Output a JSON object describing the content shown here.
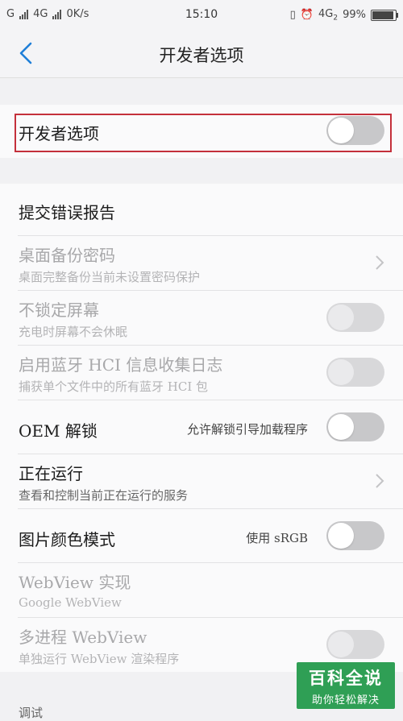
{
  "status_bar": {
    "signal1": "G",
    "signal2": "4G",
    "speed": "0K/s",
    "time": "15:10",
    "network": "4G",
    "network_sub": "2",
    "battery": "99%"
  },
  "header": {
    "title": "开发者选项"
  },
  "main_toggle": {
    "label": "开发者选项",
    "state": "off"
  },
  "items": [
    {
      "title": "提交错误报告"
    },
    {
      "title": "桌面备份密码",
      "subtitle": "桌面完整备份当前未设置密码保护",
      "control": "chevron",
      "enabled": false
    },
    {
      "title": "不锁定屏幕",
      "subtitle": "充电时屏幕不会休眠",
      "control": "toggle",
      "state": "off",
      "enabled": false
    },
    {
      "title": "启用蓝牙 HCI 信息收集日志",
      "subtitle": "捕获单个文件中的所有蓝牙 HCI 包",
      "control": "toggle",
      "state": "off",
      "enabled": false
    },
    {
      "title": "OEM 解锁",
      "value": "允许解锁引导加载程序",
      "control": "toggle",
      "state": "off",
      "enabled": true
    },
    {
      "title": "正在运行",
      "subtitle": "查看和控制当前正在运行的服务",
      "control": "chevron",
      "enabled": true
    },
    {
      "title": "图片颜色模式",
      "value": "使用 sRGB",
      "control": "toggle",
      "state": "off",
      "enabled": true
    },
    {
      "title": "WebView 实现",
      "subtitle": "Google WebView",
      "enabled": false
    },
    {
      "title": "多进程 WebView",
      "subtitle": "单独运行 WebView 渲染程序",
      "control": "toggle",
      "state": "off",
      "enabled": false
    }
  ],
  "next_section_header": "调试",
  "watermark": {
    "title": "百科全说",
    "subtitle": "助你轻松解决"
  },
  "colors": {
    "highlight": "#c4303b",
    "accent": "#1f7fd8",
    "watermark": "#2f9f55"
  }
}
